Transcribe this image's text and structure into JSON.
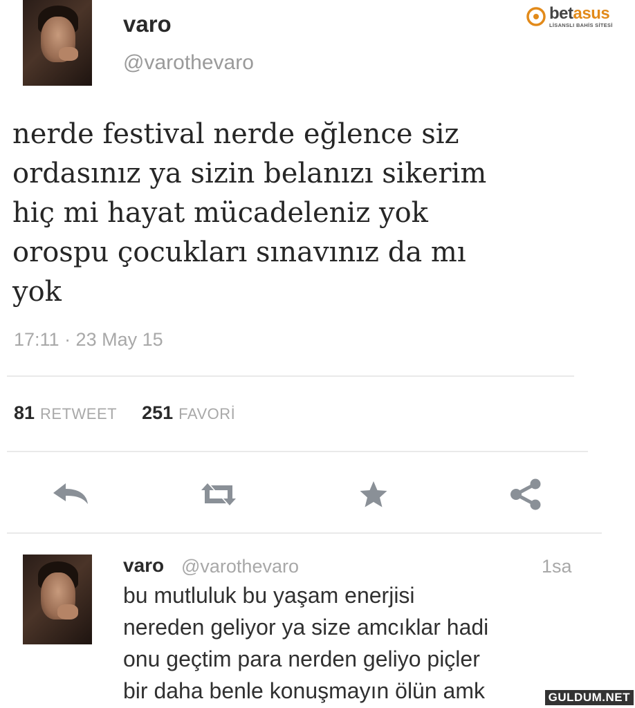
{
  "main_tweet": {
    "user": {
      "name": "varo",
      "handle": "@varothevaro"
    },
    "text_lines": [
      "nerde festival nerde eğlence siz",
      "ordasınız ya sizin belanızı sikerim",
      "hiç mi hayat mücadeleniz yok",
      "orospu çocukları sınavınız da mı",
      "yok"
    ],
    "timestamp": "17:11 · 23 May 15",
    "stats": {
      "retweet_count": "81",
      "retweet_label": "RETWEET",
      "favorite_count": "251",
      "favorite_label": "FAVORİ"
    },
    "actions": [
      {
        "icon": "reply-icon"
      },
      {
        "icon": "retweet-icon"
      },
      {
        "icon": "favorite-star-icon"
      },
      {
        "icon": "share-icon"
      }
    ]
  },
  "reply_tweet": {
    "user": {
      "name": "varo",
      "handle": "@varothevaro"
    },
    "time": "1sa",
    "text_lines": [
      "bu mutluluk bu yaşam enerjisi",
      "nereden geliyor ya size amcıklar hadi",
      "onu geçtim para nerden geliyo piçler",
      "bir daha benle konuşmayın ölün amk"
    ]
  },
  "watermarks": {
    "brand_name_prefix": "bet",
    "brand_name_accent": "asus",
    "brand_tagline": "LİSANSLI BAHİS SİTESİ",
    "site": "GULDUM.NET"
  },
  "colors": {
    "accent_orange": "#e28a1a",
    "icon_gray": "#8a9097",
    "muted_text": "#a8a8a8"
  }
}
